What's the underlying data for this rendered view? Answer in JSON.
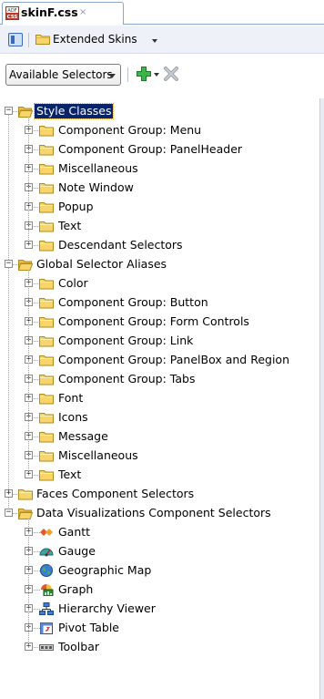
{
  "editor_tab": {
    "title": "skinF.css",
    "close_glyph": "×",
    "icon": "css-file-icon",
    "icon_text_top": "ADF",
    "icon_text_bottom": "CSS"
  },
  "toolbar": {
    "panel_toggle_icon": "panel-toggle-icon",
    "skins_label": "Extended Skins",
    "skins_icon": "folder-icon"
  },
  "selectors_bar": {
    "dropdown_value": "Available Selectors",
    "add_icon": "plus-icon",
    "delete_icon": "delete-icon"
  },
  "tree": [
    {
      "label": "Style Classes",
      "level": 0,
      "expanded": true,
      "selected": true,
      "icon": "folder-open-icon",
      "children": [
        {
          "label": "Component Group: Menu",
          "icon": "folder-icon"
        },
        {
          "label": "Component Group: PanelHeader",
          "icon": "folder-icon"
        },
        {
          "label": "Miscellaneous",
          "icon": "folder-icon"
        },
        {
          "label": "Note Window",
          "icon": "folder-icon"
        },
        {
          "label": "Popup",
          "icon": "folder-icon"
        },
        {
          "label": "Text",
          "icon": "folder-icon"
        },
        {
          "label": "Descendant Selectors",
          "icon": "folder-icon"
        }
      ]
    },
    {
      "label": "Global Selector Aliases",
      "level": 0,
      "expanded": true,
      "selected": false,
      "icon": "folder-open-icon",
      "children": [
        {
          "label": "Color",
          "icon": "folder-icon"
        },
        {
          "label": "Component Group: Button",
          "icon": "folder-icon"
        },
        {
          "label": "Component Group: Form Controls",
          "icon": "folder-icon"
        },
        {
          "label": "Component Group: Link",
          "icon": "folder-icon"
        },
        {
          "label": "Component Group: PanelBox and Region",
          "icon": "folder-icon"
        },
        {
          "label": "Component Group: Tabs",
          "icon": "folder-icon"
        },
        {
          "label": "Font",
          "icon": "folder-icon"
        },
        {
          "label": "Icons",
          "icon": "folder-icon"
        },
        {
          "label": "Message",
          "icon": "folder-icon"
        },
        {
          "label": "Miscellaneous",
          "icon": "folder-icon"
        },
        {
          "label": "Text",
          "icon": "folder-icon"
        }
      ]
    },
    {
      "label": "Faces Component Selectors",
      "level": 0,
      "expanded": false,
      "selected": false,
      "icon": "folder-icon",
      "children": []
    },
    {
      "label": "Data Visualizations Component Selectors",
      "level": 0,
      "expanded": true,
      "selected": false,
      "icon": "folder-open-icon",
      "children": [
        {
          "label": "Gantt",
          "icon": "gantt-icon"
        },
        {
          "label": "Gauge",
          "icon": "gauge-icon"
        },
        {
          "label": "Geographic Map",
          "icon": "geographic-map-icon"
        },
        {
          "label": "Graph",
          "icon": "graph-icon"
        },
        {
          "label": "Hierarchy Viewer",
          "icon": "hierarchy-viewer-icon"
        },
        {
          "label": "Pivot Table",
          "icon": "pivot-table-icon"
        },
        {
          "label": "Toolbar",
          "icon": "toolbar-icon"
        }
      ]
    }
  ],
  "colors": {
    "selection_bg": "#0a246a",
    "selection_fg": "#ffffff",
    "folder_yellow": "#f7d56b",
    "toolbar_bg": "#eef2f8"
  }
}
